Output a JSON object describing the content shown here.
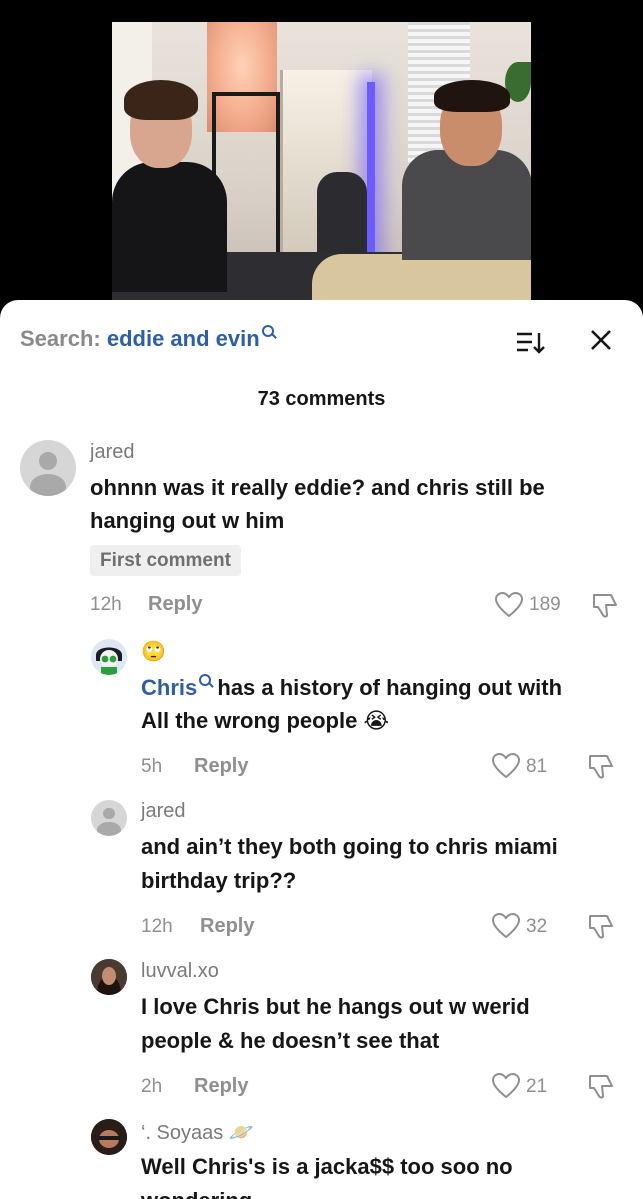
{
  "search": {
    "prefix": "Search:",
    "query": "eddie and evin"
  },
  "comments_count": "73 comments",
  "comments": [
    {
      "username": "jared",
      "text_line1": "ohnnn was it really eddie? and chris still be",
      "text_line2": "hanging out w him",
      "badge": "First comment",
      "time": "12h",
      "reply_label": "Reply",
      "likes": "189"
    },
    {
      "username_emoji": "🙄",
      "mention": "Chris",
      "text_line1_rest": "has a history of hanging out with",
      "text_line2": "All the wrong people",
      "text_line2_emoji": "😭",
      "time": "5h",
      "reply_label": "Reply",
      "likes": "81"
    },
    {
      "username": "jared",
      "text_line1": "and ain’t they both going to chris miami",
      "text_line2": "birthday trip??",
      "time": "12h",
      "reply_label": "Reply",
      "likes": "32"
    },
    {
      "username": "luvval.xo",
      "text_line1": "I love Chris but he hangs out w werid",
      "text_line2": "people & he doesn’t see that",
      "time": "2h",
      "reply_label": "Reply",
      "likes": "21"
    },
    {
      "username": "‘. Soyaas",
      "username_emoji": "🪐",
      "text_line1": "Well Chris's is a jacka$$ too soo no",
      "text_line2": "wondering"
    }
  ],
  "icons": {
    "search": "search-icon",
    "sort": "sort-icon",
    "close": "close-icon",
    "like": "heart-icon",
    "dislike": "dislike-icon"
  },
  "colors": {
    "accent": "#2d5fa8",
    "muted": "#8f8f8f",
    "text": "#161616"
  }
}
